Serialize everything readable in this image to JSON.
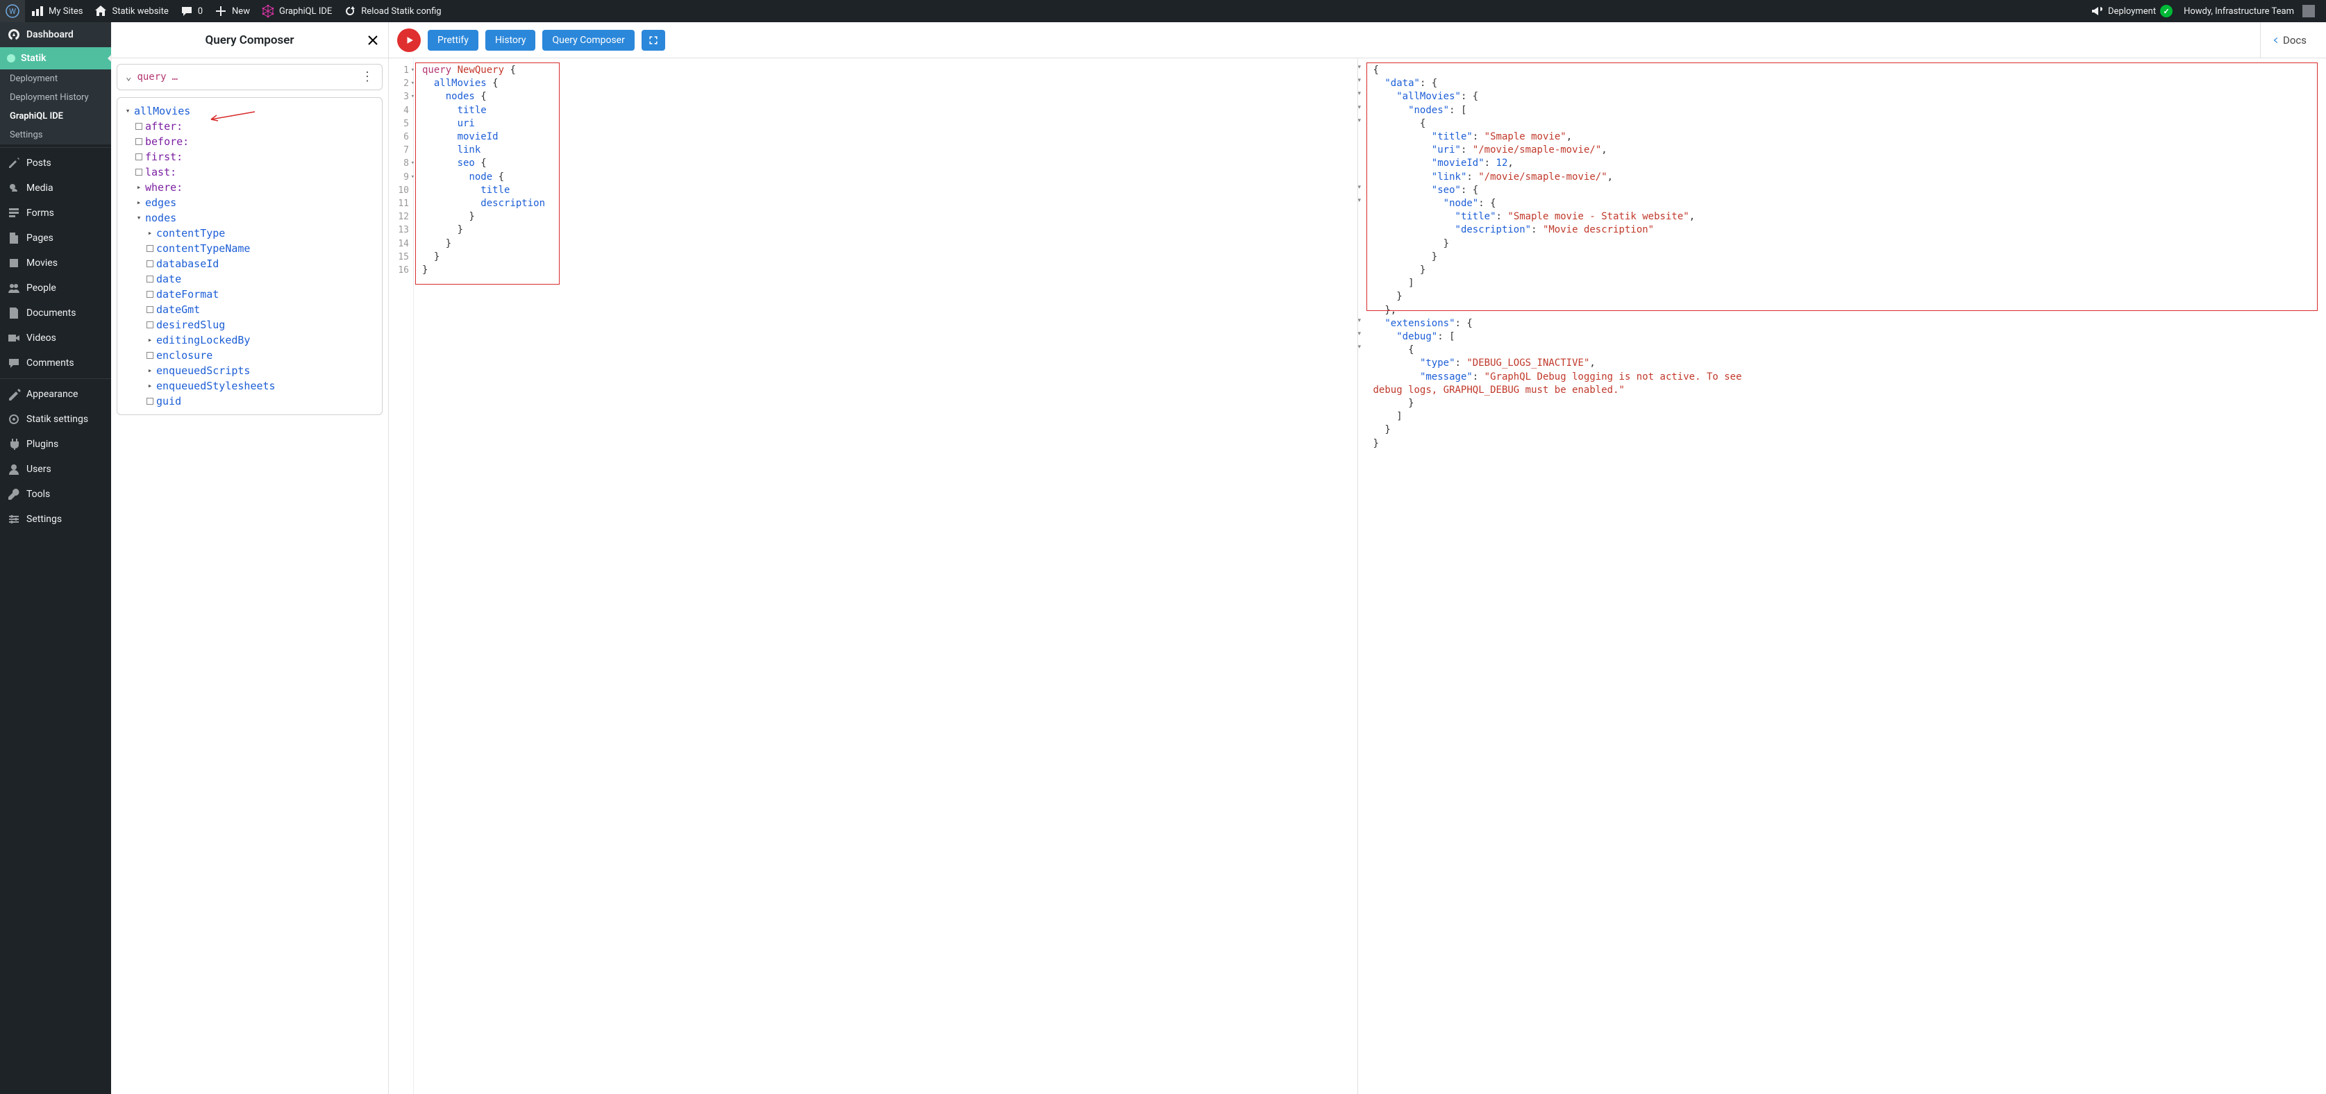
{
  "adminbar": {
    "my_sites": "My Sites",
    "site_name": "Statik website",
    "comments_count": "0",
    "new": "New",
    "graphiql": "GraphiQL IDE",
    "reload": "Reload Statik config",
    "deployment": "Deployment",
    "howdy": "Howdy, Infrastructure Team"
  },
  "sidebar": {
    "dashboard": "Dashboard",
    "statik": "Statik",
    "submenu": {
      "deployment": "Deployment",
      "history": "Deployment History",
      "graphiql": "GraphiQL IDE",
      "settings": "Settings"
    },
    "posts": "Posts",
    "media": "Media",
    "forms": "Forms",
    "pages": "Pages",
    "movies": "Movies",
    "people": "People",
    "documents": "Documents",
    "videos": "Videos",
    "comments": "Comments",
    "appearance": "Appearance",
    "statik_settings": "Statik settings",
    "plugins": "Plugins",
    "users": "Users",
    "tools": "Tools",
    "settings2": "Settings"
  },
  "composer": {
    "title": "Query Composer",
    "query_label": "query",
    "ellipsis": "…",
    "root": "allMovies",
    "fields_purple": [
      "after:",
      "before:",
      "first:",
      "last:",
      "where:"
    ],
    "edges": "edges",
    "nodes": "nodes",
    "node_children": [
      "contentType",
      "contentTypeName",
      "databaseId",
      "date",
      "dateFormat",
      "dateGmt",
      "desiredSlug",
      "editingLockedBy",
      "enclosure",
      "enqueuedScripts",
      "enqueuedStylesheets",
      "guid"
    ]
  },
  "toolbar": {
    "prettify": "Prettify",
    "history": "History",
    "query_composer": "Query Composer",
    "docs": "Docs"
  },
  "query_editor": {
    "lines": [
      "1",
      "2",
      "3",
      "4",
      "5",
      "6",
      "7",
      "8",
      "9",
      "10",
      "11",
      "12",
      "13",
      "14",
      "15",
      "16"
    ],
    "code_tokens": [
      [
        "kw",
        "query"
      ],
      [
        "sp",
        " "
      ],
      [
        "name",
        "NewQuery"
      ],
      [
        "sp",
        " "
      ],
      [
        "p",
        "{"
      ],
      [
        "nl"
      ],
      [
        "sp",
        "  "
      ],
      [
        "fn",
        "allMovies"
      ],
      [
        "sp",
        " "
      ],
      [
        "p",
        "{"
      ],
      [
        "nl"
      ],
      [
        "sp",
        "    "
      ],
      [
        "fn",
        "nodes"
      ],
      [
        "sp",
        " "
      ],
      [
        "p",
        "{"
      ],
      [
        "nl"
      ],
      [
        "sp",
        "      "
      ],
      [
        "fn",
        "title"
      ],
      [
        "nl"
      ],
      [
        "sp",
        "      "
      ],
      [
        "fn",
        "uri"
      ],
      [
        "nl"
      ],
      [
        "sp",
        "      "
      ],
      [
        "fn",
        "movieId"
      ],
      [
        "nl"
      ],
      [
        "sp",
        "      "
      ],
      [
        "fn",
        "link"
      ],
      [
        "nl"
      ],
      [
        "sp",
        "      "
      ],
      [
        "fn",
        "seo"
      ],
      [
        "sp",
        " "
      ],
      [
        "p",
        "{"
      ],
      [
        "nl"
      ],
      [
        "sp",
        "        "
      ],
      [
        "fn",
        "node"
      ],
      [
        "sp",
        " "
      ],
      [
        "p",
        "{"
      ],
      [
        "nl"
      ],
      [
        "sp",
        "          "
      ],
      [
        "fn",
        "title"
      ],
      [
        "nl"
      ],
      [
        "sp",
        "          "
      ],
      [
        "fn",
        "description"
      ],
      [
        "nl"
      ],
      [
        "sp",
        "        "
      ],
      [
        "p",
        "}"
      ],
      [
        "nl"
      ],
      [
        "sp",
        "      "
      ],
      [
        "p",
        "}"
      ],
      [
        "nl"
      ],
      [
        "sp",
        "    "
      ],
      [
        "p",
        "}"
      ],
      [
        "nl"
      ],
      [
        "sp",
        "  "
      ],
      [
        "p",
        "}"
      ],
      [
        "nl"
      ],
      [
        "p",
        "}"
      ]
    ]
  },
  "result": {
    "tokens": [
      [
        "p",
        "{"
      ],
      [
        "nl"
      ],
      [
        "sp",
        "  "
      ],
      [
        "key",
        "\"data\""
      ],
      [
        "p",
        ": {"
      ],
      [
        "nl"
      ],
      [
        "sp",
        "    "
      ],
      [
        "key",
        "\"allMovies\""
      ],
      [
        "p",
        ": {"
      ],
      [
        "nl"
      ],
      [
        "sp",
        "      "
      ],
      [
        "key",
        "\"nodes\""
      ],
      [
        "p",
        ": ["
      ],
      [
        "nl"
      ],
      [
        "sp",
        "        "
      ],
      [
        "p",
        "{"
      ],
      [
        "nl"
      ],
      [
        "sp",
        "          "
      ],
      [
        "key",
        "\"title\""
      ],
      [
        "p",
        ": "
      ],
      [
        "str",
        "\"Smaple movie\""
      ],
      [
        "p",
        ","
      ],
      [
        "nl"
      ],
      [
        "sp",
        "          "
      ],
      [
        "key",
        "\"uri\""
      ],
      [
        "p",
        ": "
      ],
      [
        "str",
        "\"/movie/smaple-movie/\""
      ],
      [
        "p",
        ","
      ],
      [
        "nl"
      ],
      [
        "sp",
        "          "
      ],
      [
        "key",
        "\"movieId\""
      ],
      [
        "p",
        ": "
      ],
      [
        "num",
        "12"
      ],
      [
        "p",
        ","
      ],
      [
        "nl"
      ],
      [
        "sp",
        "          "
      ],
      [
        "key",
        "\"link\""
      ],
      [
        "p",
        ": "
      ],
      [
        "str",
        "\"/movie/smaple-movie/\""
      ],
      [
        "p",
        ","
      ],
      [
        "nl"
      ],
      [
        "sp",
        "          "
      ],
      [
        "key",
        "\"seo\""
      ],
      [
        "p",
        ": {"
      ],
      [
        "nl"
      ],
      [
        "sp",
        "            "
      ],
      [
        "key",
        "\"node\""
      ],
      [
        "p",
        ": {"
      ],
      [
        "nl"
      ],
      [
        "sp",
        "              "
      ],
      [
        "key",
        "\"title\""
      ],
      [
        "p",
        ": "
      ],
      [
        "str",
        "\"Smaple movie - Statik website\""
      ],
      [
        "p",
        ","
      ],
      [
        "nl"
      ],
      [
        "sp",
        "              "
      ],
      [
        "key",
        "\"description\""
      ],
      [
        "p",
        ": "
      ],
      [
        "str",
        "\"Movie description\""
      ],
      [
        "nl"
      ],
      [
        "sp",
        "            "
      ],
      [
        "p",
        "}"
      ],
      [
        "nl"
      ],
      [
        "sp",
        "          "
      ],
      [
        "p",
        "}"
      ],
      [
        "nl"
      ],
      [
        "sp",
        "        "
      ],
      [
        "p",
        "}"
      ],
      [
        "nl"
      ],
      [
        "sp",
        "      "
      ],
      [
        "p",
        "]"
      ],
      [
        "nl"
      ],
      [
        "sp",
        "    "
      ],
      [
        "p",
        "}"
      ],
      [
        "nl"
      ],
      [
        "sp",
        "  "
      ],
      [
        "p",
        "},"
      ],
      [
        "nl"
      ],
      [
        "sp",
        "  "
      ],
      [
        "key",
        "\"extensions\""
      ],
      [
        "p",
        ": {"
      ],
      [
        "nl"
      ],
      [
        "sp",
        "    "
      ],
      [
        "key",
        "\"debug\""
      ],
      [
        "p",
        ": ["
      ],
      [
        "nl"
      ],
      [
        "sp",
        "      "
      ],
      [
        "p",
        "{"
      ],
      [
        "nl"
      ],
      [
        "sp",
        "        "
      ],
      [
        "key",
        "\"type\""
      ],
      [
        "p",
        ": "
      ],
      [
        "str",
        "\"DEBUG_LOGS_INACTIVE\""
      ],
      [
        "p",
        ","
      ],
      [
        "nl"
      ],
      [
        "sp",
        "        "
      ],
      [
        "key",
        "\"message\""
      ],
      [
        "p",
        ": "
      ],
      [
        "str",
        "\"GraphQL Debug logging is not active. To see\ndebug logs, GRAPHQL_DEBUG must be enabled.\""
      ],
      [
        "nl"
      ],
      [
        "sp",
        "      "
      ],
      [
        "p",
        "}"
      ],
      [
        "nl"
      ],
      [
        "sp",
        "    "
      ],
      [
        "p",
        "]"
      ],
      [
        "nl"
      ],
      [
        "sp",
        "  "
      ],
      [
        "p",
        "}"
      ],
      [
        "nl"
      ],
      [
        "p",
        "}"
      ]
    ]
  }
}
